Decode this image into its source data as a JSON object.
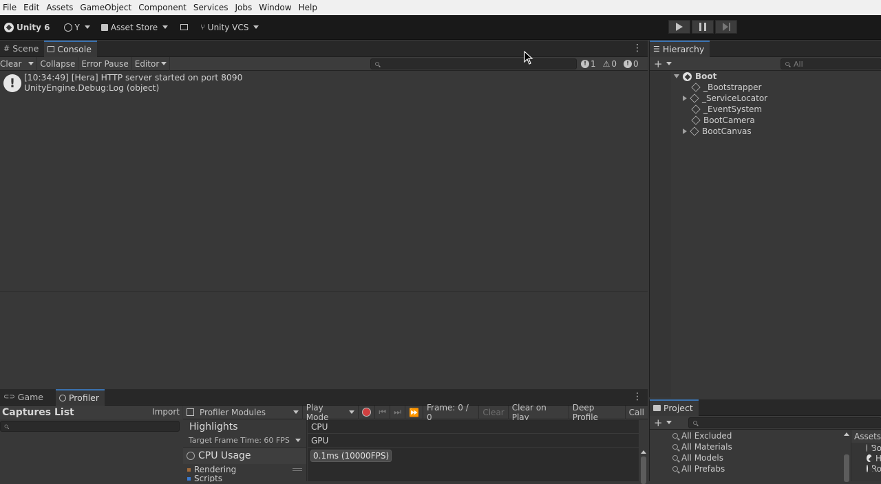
{
  "menu": [
    "File",
    "Edit",
    "Assets",
    "GameObject",
    "Component",
    "Services",
    "Jobs",
    "Window",
    "Help"
  ],
  "toolbar": {
    "product": "Unity 6",
    "account": "Y",
    "asset_store": "Asset Store",
    "vcs": "Unity VCS"
  },
  "scene_panel": {
    "tabs": [
      "Scene",
      "Console"
    ],
    "console": {
      "clear": "Clear",
      "collapse": "Collapse",
      "error_pause": "Error Pause",
      "editor": "Editor",
      "counts": {
        "errors": "1",
        "warnings": "0",
        "info": "0"
      },
      "log": {
        "line1": "[10:34:49] [Hera] HTTP server started on port 8090",
        "line2": "UnityEngine.Debug:Log (object)"
      }
    }
  },
  "hierarchy": {
    "tab": "Hierarchy",
    "search_placeholder": "All",
    "root": "Boot",
    "items": [
      {
        "label": "_Bootstrapper",
        "expandable": false
      },
      {
        "label": "_ServiceLocator",
        "expandable": true
      },
      {
        "label": "_EventSystem",
        "expandable": false
      },
      {
        "label": "BootCamera",
        "expandable": false
      },
      {
        "label": "BootCanvas",
        "expandable": true
      }
    ]
  },
  "bottom_panel": {
    "tabs": [
      "Game",
      "Profiler"
    ],
    "captures_title": "Captures List",
    "import": "Import",
    "modules": "Profiler Modules",
    "play_mode": "Play Mode",
    "frame": "Frame: 0 / 0",
    "clear": "Clear",
    "clear_on_play": "Clear on Play",
    "deep_profile": "Deep Profile",
    "call": "Call",
    "highlights": "Highlights",
    "target_frame": "Target Frame Time: 60 FPS",
    "cpu": "CPU",
    "gpu": "GPU",
    "cpu_usage": "CPU Usage",
    "cpu_value": "0.1ms (10000FPS)",
    "rendering": "Rendering",
    "scripts": "Scripts"
  },
  "project": {
    "tab": "Project",
    "filters": [
      "All Excluded",
      "All Materials",
      "All Models",
      "All Prefabs"
    ],
    "assets_header": "Assets",
    "asset_items": [
      "Bo",
      "H",
      "Ro"
    ]
  },
  "colors": {
    "accent": "#3a72b0",
    "record": "#d04040"
  }
}
